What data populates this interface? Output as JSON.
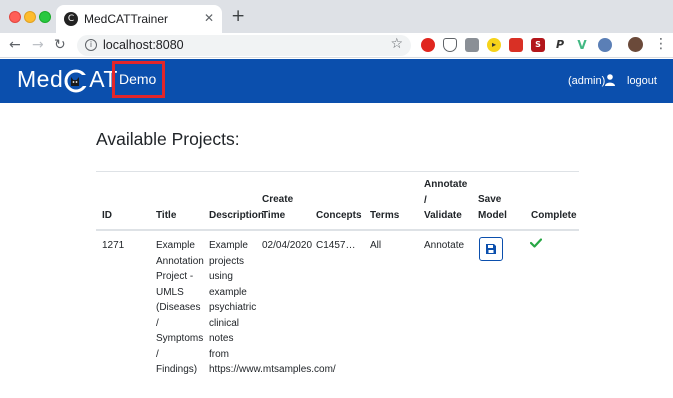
{
  "browser": {
    "tab_title": "MedCATTrainer",
    "url": "localhost:8080"
  },
  "app": {
    "brand_left": "Med",
    "brand_right": "AT",
    "project_label": "Demo",
    "admin_label": "(admin)",
    "logout_label": "logout",
    "brand_color": "#0b4fad",
    "highlight_color": "#e3262b"
  },
  "main": {
    "title": "Available Projects:",
    "columns": {
      "id": "ID",
      "title": "Title",
      "description": "Description",
      "create_time": [
        "Create",
        "Time"
      ],
      "concepts": "Concepts",
      "terms": "Terms",
      "annotate": [
        "Annotate",
        "/",
        "Validate"
      ],
      "save_model": [
        "Save",
        "Model"
      ],
      "complete": "Complete"
    },
    "rows": [
      {
        "id": "1271",
        "title_lines": [
          "Example",
          "Annotation",
          "Project -",
          "UMLS",
          "(Diseases",
          "/",
          "Symptoms",
          "/",
          "Findings)"
        ],
        "description_lines": [
          "Example",
          "projects",
          "using",
          "example",
          "psychiatric",
          "clinical",
          "notes",
          "from",
          "https://www.mtsamples.com/"
        ],
        "create_time": "02/04/2020",
        "concepts": "C1457…",
        "terms": "All",
        "annotate": "Annotate",
        "save_icon": "save-icon",
        "complete_icon": "check-icon"
      }
    ]
  }
}
